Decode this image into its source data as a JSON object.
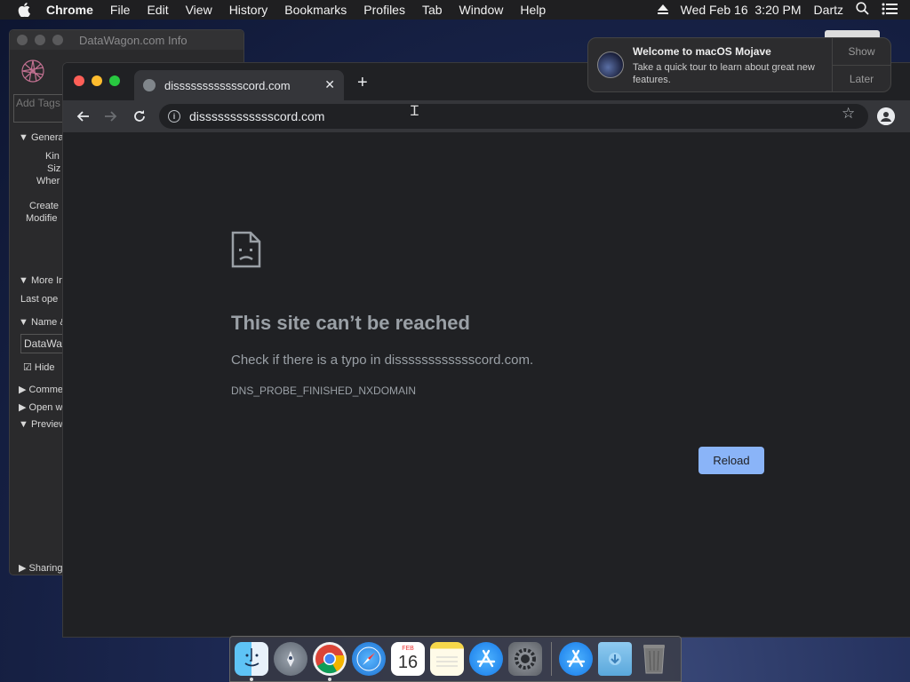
{
  "menubar": {
    "app": "Chrome",
    "items": [
      "File",
      "Edit",
      "View",
      "History",
      "Bookmarks",
      "Profiles",
      "Tab",
      "Window",
      "Help"
    ],
    "datetime": "Wed Feb 16  3:20 PM",
    "user": "Dartz"
  },
  "info_window": {
    "title": "DataWagon.com Info",
    "tags_placeholder": "Add Tags",
    "rows": [
      "Genera",
      "Kin",
      "Siz",
      "Wher",
      "Create",
      "Modifie",
      "More In",
      "Last ope",
      "Name &",
      "DataWa",
      "Hide",
      "Comme",
      "Open w",
      "Preview",
      "Sharing"
    ]
  },
  "chrome": {
    "tab_title": "disssssssssssscord.com",
    "url": "disssssssssssscord.com",
    "error": {
      "title": "This site can’t be reached",
      "description": "Check if there is a typo in disssssssssssscord.com.",
      "code": "DNS_PROBE_FINISHED_NXDOMAIN",
      "reload_label": "Reload"
    }
  },
  "notification": {
    "title": "Welcome to macOS Mojave",
    "body": "Take a quick tour to learn about great new features.",
    "show_label": "Show",
    "later_label": "Later"
  },
  "dock": {
    "calendar_day": "16",
    "calendar_month": "FEB",
    "icons": [
      "finder-icon",
      "launchpad-icon",
      "chrome-icon",
      "safari-icon",
      "calendar-icon",
      "notes-icon",
      "app-store-icon",
      "system-preferences-icon",
      "app-store-icon",
      "downloads-folder-icon",
      "trash-icon"
    ]
  }
}
